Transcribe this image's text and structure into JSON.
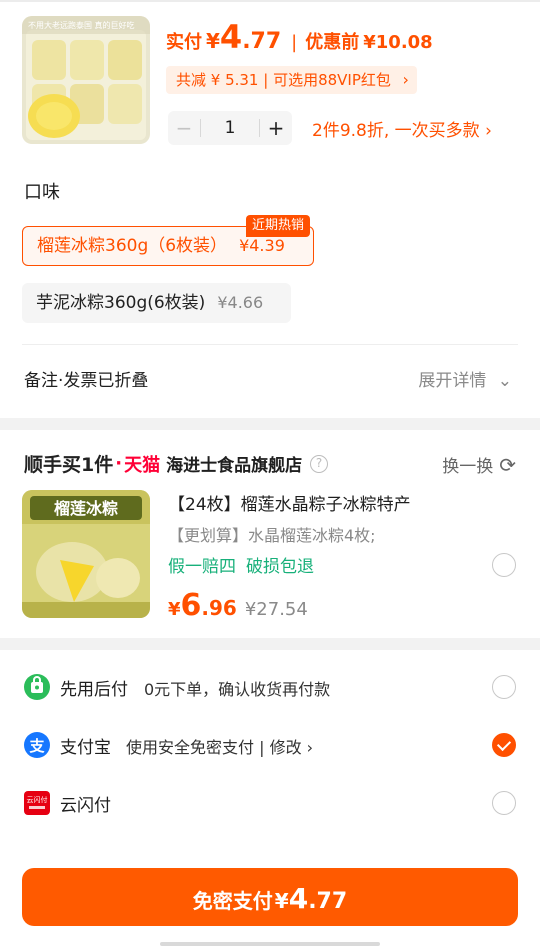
{
  "product": {
    "image_caption": "不用大老远跑泰国 真的巨好吃",
    "actual_label": "实付",
    "currency": "¥",
    "price_int": "4",
    "price_dec": ".77",
    "separator": "|",
    "before_label": "优惠前",
    "before_price": "¥10.08",
    "discount_text": "共减 ¥ 5.31 | 可选用88VIP红包",
    "chevron": "›",
    "quantity": "1",
    "minus": "−",
    "plus": "+",
    "promo_text": "2件9.8折, 一次买多款 ›"
  },
  "flavor": {
    "title": "口味",
    "options": [
      {
        "name": "榴莲冰粽360g（6枚装）",
        "price": "¥4.39",
        "tag": "近期热销",
        "selected": true
      },
      {
        "name": "芋泥冰粽360g(6枚装)",
        "price": "¥4.66",
        "selected": false
      }
    ]
  },
  "remark": {
    "label": "备注·发票已折叠",
    "expand": "展开详情",
    "expand_icon": "⌄"
  },
  "addon": {
    "brand_prefix": "顺手买1件",
    "dot": "·",
    "tmall": "天猫",
    "store": "海进士食品旗舰店",
    "help": "?",
    "swap_label": "换一换",
    "swap_icon": "⟳",
    "image_text": "榴莲冰粽",
    "title": "【24枚】榴莲水晶粽子冰粽特产",
    "subtitle": "【更划算】水晶榴莲冰粽4枚;",
    "tags": [
      "假一赔四",
      "破损包退"
    ],
    "currency": "¥",
    "price_int": "6",
    "price_dec": ".96",
    "orig_price": "¥27.54"
  },
  "payment": {
    "methods": [
      {
        "name": "先用后付",
        "desc": "0元下单，确认收货再付款",
        "selected": false,
        "color": "#2bbd5a"
      },
      {
        "name": "支付宝",
        "desc": "使用安全免密支付 | 修改 ›",
        "selected": true,
        "color": "#1677ff"
      },
      {
        "name": "云闪付",
        "desc": "",
        "selected": false,
        "color": "#e60012"
      }
    ],
    "unionpay_badge": "云闪付"
  },
  "submit": {
    "label": "免密支付",
    "currency": "¥",
    "price_int": "4",
    "price_dec": ".77"
  },
  "colors": {
    "accent": "#ff5000",
    "tmall_red": "#ff0036",
    "guarantee_green": "#17b07a"
  }
}
